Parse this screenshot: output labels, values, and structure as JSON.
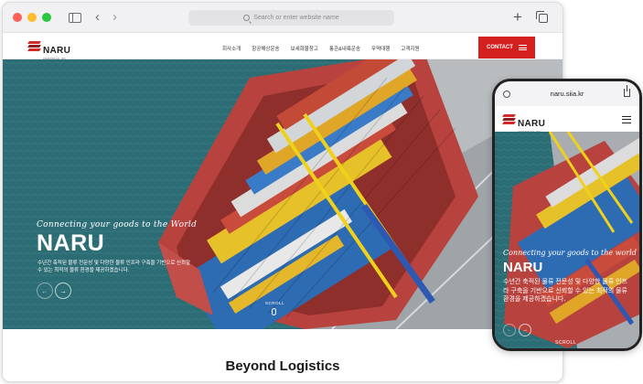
{
  "browser": {
    "address_placeholder": "Search or enter website name"
  },
  "site": {
    "brand": "NARU",
    "brand_sub": "LOGISTICS CO., LTD.",
    "menu": [
      "회사소개",
      "항공해상운송",
      "보세화물창고",
      "통관&내륙운송",
      "무역대행",
      "고객지원"
    ],
    "contact_label": "CONTACT",
    "accent": "#d41f1f"
  },
  "hero": {
    "tagline": "Connecting your goods to the World",
    "title": "NARU",
    "description": "수년간 축적된 물류 전문성 및 다양한 물류 인프라 구축을 기반으로 신뢰할 수 있는 최적의 물류 환경을 제공하겠습니다.",
    "prev_icon": "←",
    "next_icon": "→",
    "scroll_label": "SCROLL"
  },
  "lower": {
    "title": "Beyond Logistics"
  },
  "phone": {
    "url": "naru.siia.kr",
    "tagline": "Connecting your goods to the world",
    "title": "NARU",
    "description": "수년간 축적된 물류 전문성 및 다양한 물류 인프라 구축을 기반으로 신뢰할 수 있는 최적의 물류 환경을 제공하겠습니다.",
    "scroll_label": "SCROLL"
  }
}
